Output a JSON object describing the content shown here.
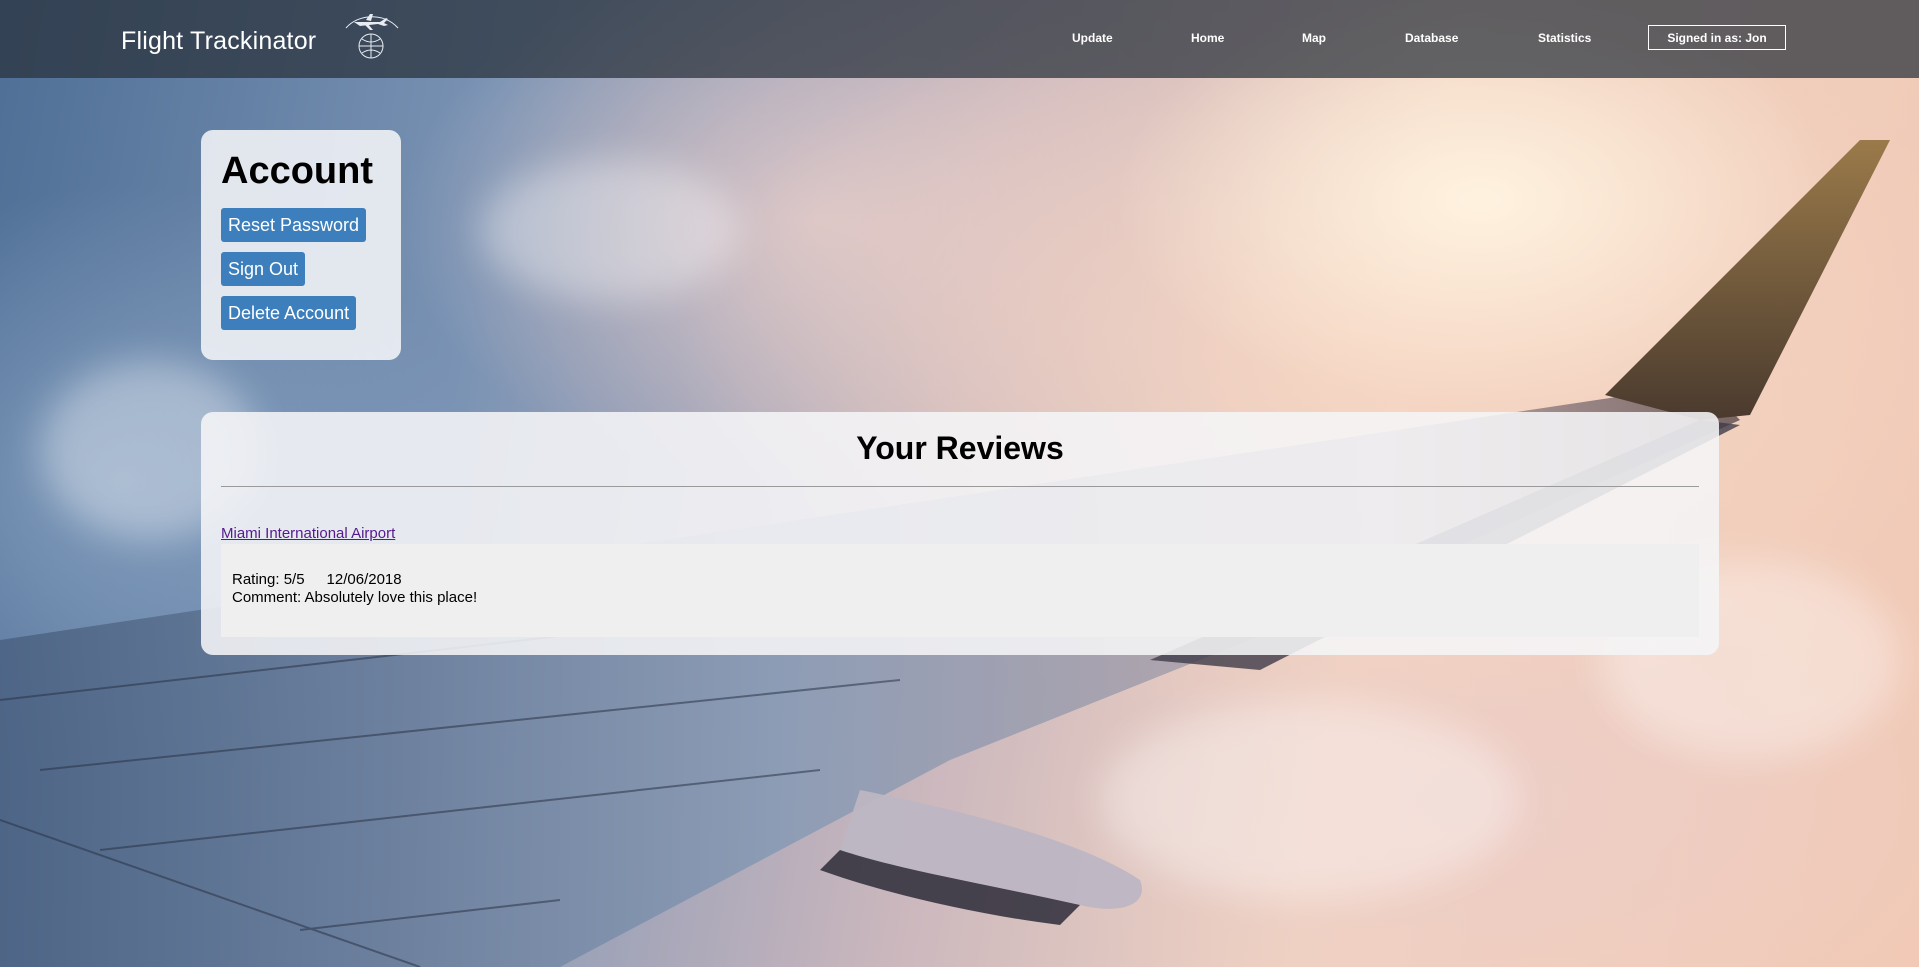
{
  "header": {
    "brand": "Flight Trackinator",
    "logo_icon": "plane-globe-icon",
    "nav": [
      "Update",
      "Home",
      "Map",
      "Database",
      "Statistics"
    ],
    "signed_in": "Signed in as: Jon"
  },
  "account": {
    "title": "Account",
    "buttons": [
      "Reset Password",
      "Sign Out",
      "Delete Account"
    ]
  },
  "reviews": {
    "title": "Your Reviews",
    "items": [
      {
        "place": "Miami International Airport",
        "rating": "Rating: 5/5",
        "date": "12/06/2018",
        "comment": "Comment: Absolutely love this place!"
      }
    ]
  },
  "colors": {
    "header_bg": "#28303a",
    "button_bg": "#3d7fbc",
    "link": "#551a8b"
  }
}
